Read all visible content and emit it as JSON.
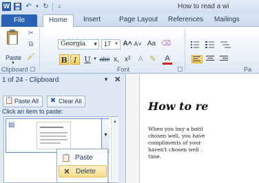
{
  "app": {
    "window_title": "How to read a wi",
    "icon_letter": "W"
  },
  "tabs": {
    "file": "File",
    "items": [
      "Home",
      "Insert",
      "Page Layout",
      "References",
      "Mailings"
    ]
  },
  "ribbon": {
    "clipboard_group": "Clipboard",
    "font_group": "Font",
    "paragraph_group": "Pa",
    "paste_label": "Paste",
    "font_name": "Georgia",
    "font_size": "17",
    "bold": "B",
    "italic": "I",
    "underline": "U",
    "strike": "abe",
    "subscript": "x,",
    "superscript": "x²",
    "grow_font": "A˄",
    "shrink_font": "A˅",
    "change_case": "Aa"
  },
  "clipboard_pane": {
    "header": "1 of 24 - Clipboard",
    "paste_all": "Paste All",
    "clear_all": "Clear All",
    "instruction": "Click an item to paste:"
  },
  "context_menu": {
    "paste": "Paste",
    "delete": "Delete"
  },
  "document": {
    "heading": "How to re",
    "lines": [
      "When you buy a bottl",
      "chosen well, you have",
      "compliments of your",
      "haven't chosen well .",
      "time."
    ]
  },
  "colors": {
    "accent": "#2b63b4",
    "highlight": "#f9dd8a"
  }
}
